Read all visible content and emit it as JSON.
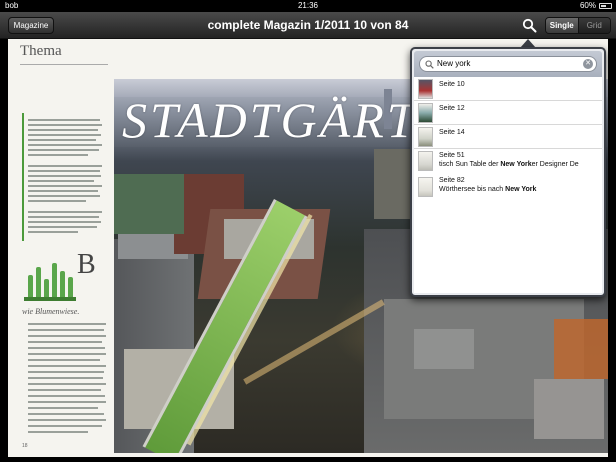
{
  "status_bar": {
    "carrier": "bob",
    "time": "21:36",
    "battery_percent": "60%",
    "battery_level": 0.6
  },
  "toolbar": {
    "magazine_button": "Magazine",
    "title": "complete Magazin 1/2011 10 von 84",
    "view_single": "Single",
    "view_grid": "Grid"
  },
  "article": {
    "section": "Thema",
    "headline": "STADTGÄRT",
    "side_caption": "wie Blumenwiese.",
    "page_number": "18"
  },
  "search": {
    "query": "New york",
    "results": [
      {
        "title": "Seite 10"
      },
      {
        "title": "Seite 12"
      },
      {
        "title": "Seite 14"
      },
      {
        "title": "Seite 51",
        "snippet_before": "tisch Sun Table der ",
        "match": "New York",
        "snippet_after": "er Designer De"
      },
      {
        "title": "Seite 82",
        "snippet_before": "Wörthersee bis nach ",
        "match": "New York",
        "snippet_after": ""
      }
    ]
  },
  "colors": {
    "toolbar": "#2f2f2f",
    "accent_green": "#4c9a3b",
    "popover_border": "#3b3f47"
  }
}
